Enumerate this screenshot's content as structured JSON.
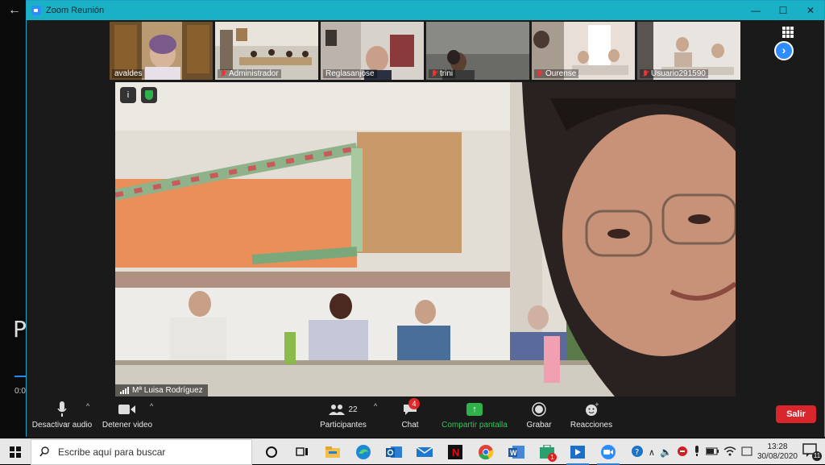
{
  "background_app": {
    "visible_text": "P",
    "time_text": "0:0"
  },
  "window": {
    "title": "Zoom Reunión",
    "minimize": "—",
    "maximize": "☐",
    "close": "✕"
  },
  "thumbnails": [
    {
      "name": "avaldes",
      "muted": false
    },
    {
      "name": "Administrador",
      "muted": true
    },
    {
      "name": "Reglasanjose",
      "muted": false
    },
    {
      "name": "trini",
      "muted": true
    },
    {
      "name": "Ourense",
      "muted": true
    },
    {
      "name": "Usuario291590",
      "muted": true
    }
  ],
  "main_video": {
    "speaker_name": "Mª Luisa Rodríguez",
    "info_icon": "i"
  },
  "toolbar": {
    "audio_label": "Desactivar audio",
    "video_label": "Detener video",
    "participants_label": "Participantes",
    "participants_count": "22",
    "chat_label": "Chat",
    "chat_badge": "4",
    "share_label": "Compartir pantalla",
    "record_label": "Grabar",
    "reactions_label": "Reacciones",
    "leave_label": "Salir"
  },
  "taskbar": {
    "search_placeholder": "Escribe aquí para buscar",
    "time": "13:28",
    "date": "30/08/2020",
    "notification_count": "11",
    "mail_badge": "1"
  },
  "colors": {
    "zoom_titlebar": "#1ab0c5",
    "share_green": "#2fb24c",
    "leave_red": "#d9262c",
    "zoom_blue": "#2d8cff"
  }
}
